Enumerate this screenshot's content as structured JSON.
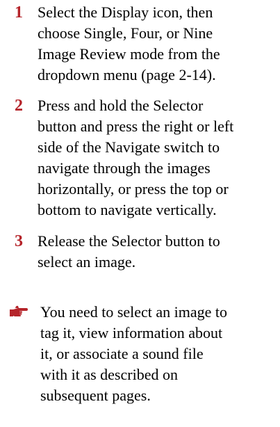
{
  "steps": [
    {
      "number": "1",
      "lines": [
        "Select the Display icon, then",
        "choose Single, Four, or Nine",
        "Image Review mode from the",
        "dropdown menu (page 2-14)."
      ]
    },
    {
      "number": "2",
      "lines": [
        "Press and hold the Selector",
        "button and press the right or left",
        "side of the Navigate switch to",
        "navigate through the images",
        "horizontally, or press the top or",
        "bottom to navigate vertically."
      ]
    },
    {
      "number": "3",
      "lines": [
        "Release the Selector button to",
        "select an image."
      ]
    }
  ],
  "note": {
    "icon": "pointing-hand-icon",
    "first_line": "You need to select an image to",
    "lines": [
      "tag it, view information about",
      "it, or associate a sound file",
      "with it as described on",
      "subsequent pages."
    ]
  },
  "colors": {
    "step_number": "#b5242a",
    "text": "#000000",
    "background": "#ffffff"
  }
}
